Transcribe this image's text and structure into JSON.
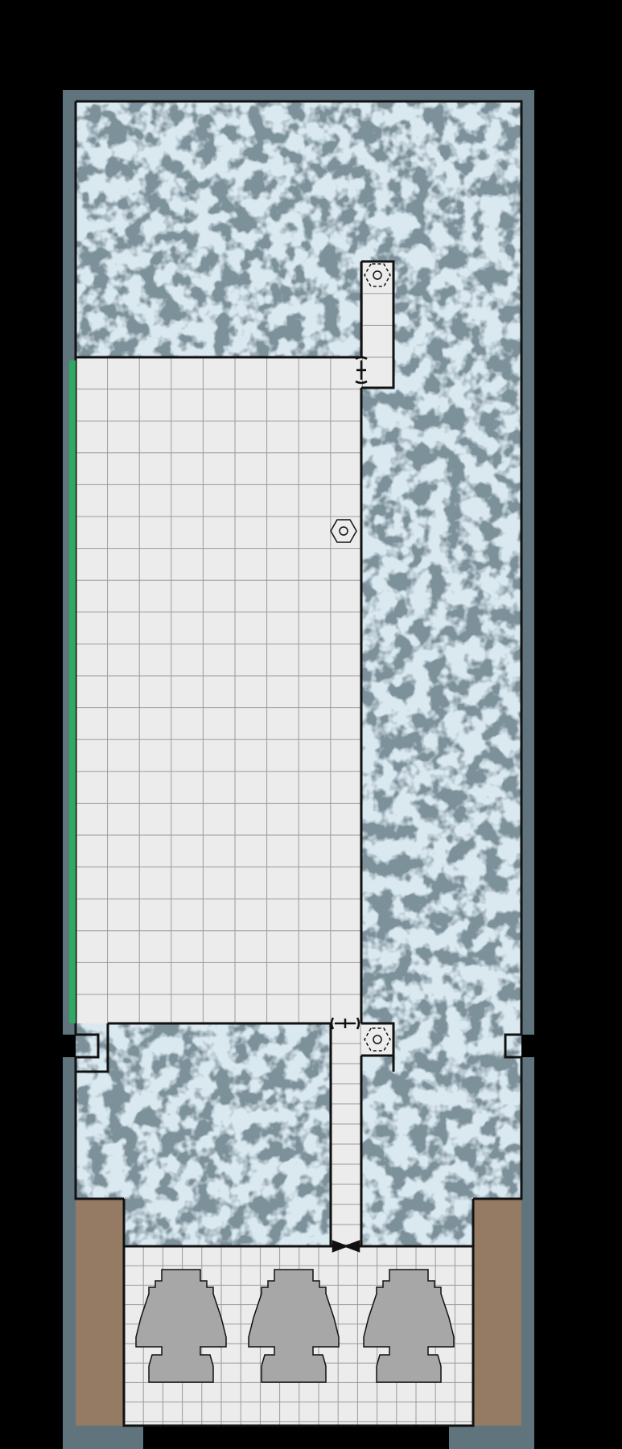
{
  "map": {
    "kind": "dungeon-floor-plan",
    "colors": {
      "background": "#000000",
      "outer_wall": "#5f747c",
      "rock_light": "#b4cfdd",
      "rock_dark": "#7d919b",
      "floor": "#ececec",
      "grid_line": "#9a9a9a",
      "wall_line": "#111111",
      "earth": "#957a64",
      "statue": "#a7a7a7",
      "doorway_marker": "#2fa862"
    },
    "statues": [
      {
        "name": "statue-left"
      },
      {
        "name": "statue-middle"
      },
      {
        "name": "statue-right"
      }
    ],
    "doors": [
      {
        "name": "door-upper-alcove"
      },
      {
        "name": "door-corridor-top"
      },
      {
        "name": "door-corridor-bottom"
      }
    ],
    "features": [
      {
        "name": "hex-marker-hall"
      },
      {
        "name": "hex-marker-alcove-top"
      },
      {
        "name": "hex-marker-alcove-bottom"
      }
    ]
  }
}
